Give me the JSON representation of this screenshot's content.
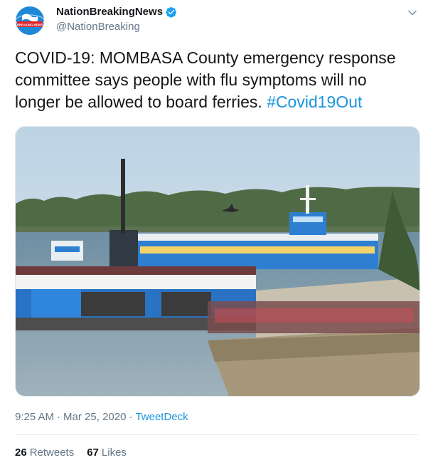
{
  "account": {
    "display_name": "NationBreakingNews",
    "handle": "@NationBreaking",
    "verified": true,
    "avatar_text": "BREAKING NEWS"
  },
  "icons": {
    "verified": "verified-badge-icon",
    "menu": "chevron-down-icon"
  },
  "tweet": {
    "text_line1": "COVID-19: MOMBASA County emergency response",
    "text_line2": "committee says people with flu symptoms will no",
    "text_line3_before": "longer be allowed to board ferries.",
    "hashtag": "#Covid19Out"
  },
  "meta": {
    "time": "9:25 AM",
    "separator": "·",
    "date": "Mar 25, 2020",
    "source": "TweetDeck"
  },
  "stats": {
    "retweets_count": "26",
    "retweets_label": "Retweets",
    "likes_count": "67",
    "likes_label": "Likes"
  },
  "colors": {
    "link": "#1b95e0",
    "secondary_text": "#657786",
    "verified": "#1da1f2",
    "ferry_blue": "#2e7fd1"
  }
}
